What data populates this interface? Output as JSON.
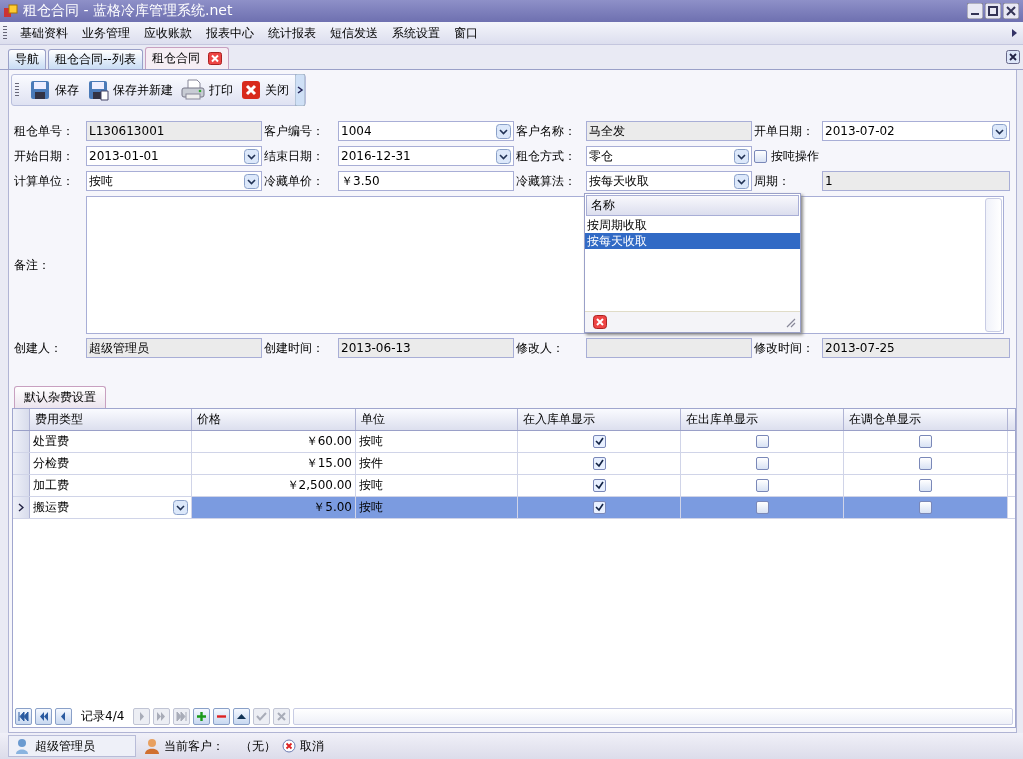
{
  "window": {
    "title": "租仓合同 - 蓝格冷库管理系统.net"
  },
  "menu": [
    "基础资料",
    "业务管理",
    "应收账款",
    "报表中心",
    "统计报表",
    "短信发送",
    "系统设置",
    "窗口"
  ],
  "tabs": [
    {
      "label": "导航",
      "selected": false
    },
    {
      "label": "租仓合同--列表",
      "selected": false
    },
    {
      "label": "租仓合同",
      "selected": true
    }
  ],
  "toolbar": [
    {
      "kind": "save",
      "label": "保存"
    },
    {
      "kind": "save-new",
      "label": "保存并新建"
    },
    {
      "kind": "print",
      "label": "打印"
    },
    {
      "kind": "close",
      "label": "关闭"
    }
  ],
  "form_rows": [
    [
      {
        "label": "租仓单号：",
        "kind": "readonly",
        "value": "L130613001"
      },
      {
        "label": "客户编号：",
        "kind": "combo",
        "value": "1004"
      },
      {
        "label": "客户名称：",
        "kind": "readonly",
        "value": "马全发"
      },
      {
        "label": "开单日期：",
        "kind": "combo",
        "value": "2013-07-02"
      }
    ],
    [
      {
        "label": "开始日期：",
        "kind": "combo",
        "value": "2013-01-01"
      },
      {
        "label": "结束日期：",
        "kind": "combo",
        "value": "2016-12-31"
      },
      {
        "label": "租仓方式：",
        "kind": "combo",
        "value": "零仓"
      },
      {
        "kind": "checkbox",
        "label": "按吨操作",
        "checked": false
      }
    ],
    [
      {
        "label": "计算单位：",
        "kind": "combo",
        "value": "按吨"
      },
      {
        "label": "冷藏单价：",
        "kind": "text",
        "value": "￥3.50"
      },
      {
        "label": "冷藏算法：",
        "kind": "combo",
        "value": "按每天收取"
      },
      {
        "label": "周期：",
        "kind": "readonly",
        "value": "1"
      }
    ]
  ],
  "remarks": {
    "label": "备注："
  },
  "dropdown": {
    "header": "名称",
    "options": [
      {
        "label": "按周期收取",
        "selected": false
      },
      {
        "label": "按每天收取",
        "selected": true
      }
    ]
  },
  "audit_row": [
    {
      "label": "创建人：",
      "value": "超级管理员"
    },
    {
      "label": "创建时间：",
      "value": "2013-06-13"
    },
    {
      "label": "修改人："
    },
    {
      "label": "修改时间：",
      "value": "2013-07-25"
    }
  ],
  "group_tab": "默认杂费设置",
  "grid": {
    "columns": [
      "费用类型",
      "价格",
      "单位",
      "在入库单显示",
      "在出库单显示",
      "在调仓单显示"
    ],
    "rows": [
      {
        "type": "处置费",
        "price": "￥60.00",
        "unit": "按吨",
        "in_stock": true,
        "out_stock": false,
        "transfer": false,
        "selected": false
      },
      {
        "type": "分检费",
        "price": "￥15.00",
        "unit": "按件",
        "in_stock": true,
        "out_stock": false,
        "transfer": false,
        "selected": false
      },
      {
        "type": "加工费",
        "price": "￥2,500.00",
        "unit": "按吨",
        "in_stock": true,
        "out_stock": false,
        "transfer": false,
        "selected": false
      },
      {
        "type": "搬运费",
        "price": "￥5.00",
        "unit": "按吨",
        "in_stock": true,
        "out_stock": false,
        "transfer": false,
        "selected": true
      }
    ]
  },
  "navigator": {
    "record": "记录4/4",
    "buttons_before": [
      {
        "kind": "first",
        "disabled": false
      },
      {
        "kind": "prev-page",
        "disabled": false
      },
      {
        "kind": "prev",
        "disabled": false
      }
    ],
    "buttons_after": [
      {
        "kind": "next",
        "disabled": true
      },
      {
        "kind": "next-page",
        "disabled": true
      },
      {
        "kind": "last",
        "disabled": true
      },
      {
        "kind": "add",
        "disabled": false
      },
      {
        "kind": "remove",
        "disabled": false
      },
      {
        "kind": "up",
        "disabled": false
      },
      {
        "kind": "confirm",
        "disabled": true
      },
      {
        "kind": "cancel",
        "disabled": true
      }
    ]
  },
  "status_bar": {
    "user": "超级管理员",
    "customer_label": "当前客户：",
    "customer": "（无）",
    "cancel": "取消"
  }
}
